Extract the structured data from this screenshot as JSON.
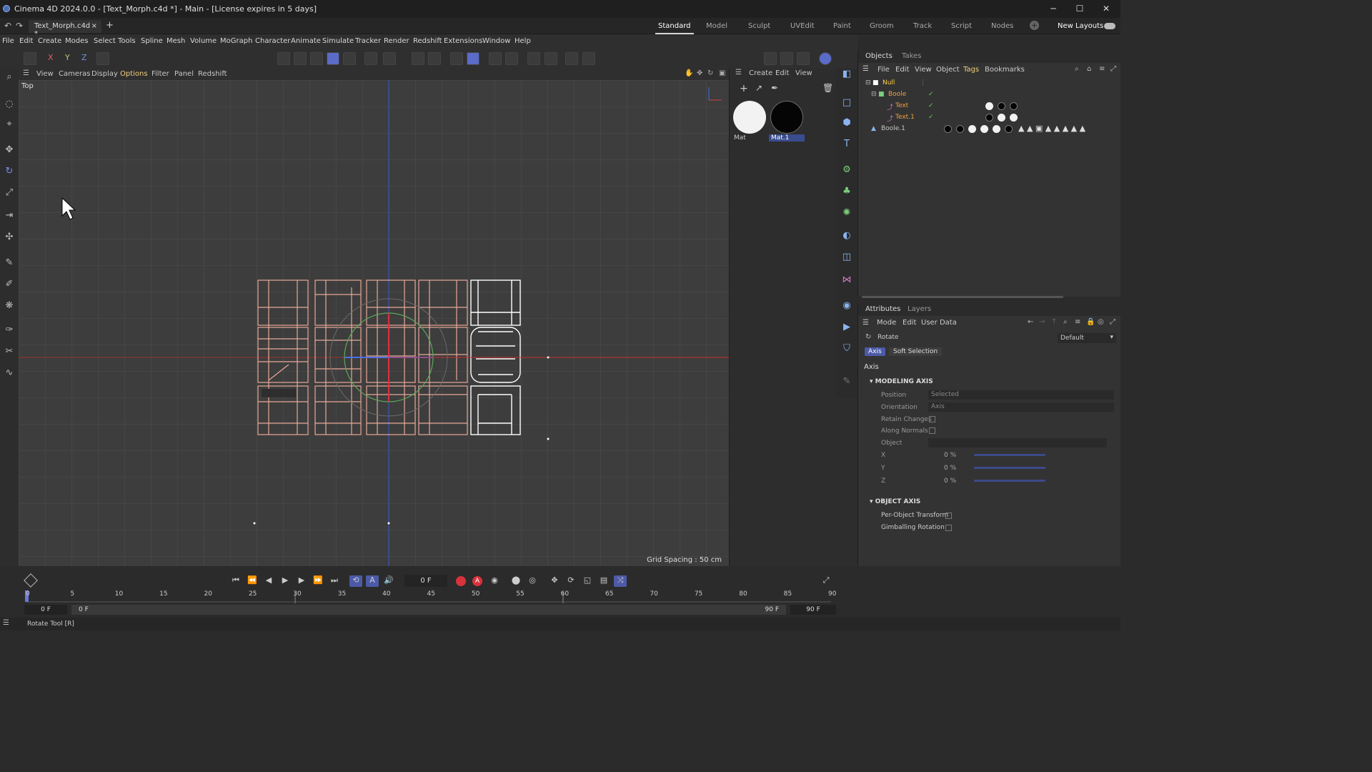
{
  "window": {
    "title": "Cinema 4D 2024.0.0 - [Text_Morph.c4d *] - Main - [License expires in 5 days]"
  },
  "tabs": {
    "doc": "Text_Morph.c4d *",
    "plus": "+",
    "close": "×"
  },
  "layouts": [
    "Standard",
    "Model",
    "Sculpt",
    "UVEdit",
    "Paint",
    "Groom",
    "Track",
    "Script",
    "Nodes"
  ],
  "new_layouts": "New Layouts",
  "menu": [
    "File",
    "Edit",
    "Create",
    "Modes",
    "Select",
    "Tools",
    "Spline",
    "Mesh",
    "Volume",
    "MoGraph",
    "Character",
    "Animate",
    "Simulate",
    "Tracker",
    "Render",
    "Redshift",
    "Extensions",
    "Window",
    "Help"
  ],
  "axes": {
    "x": "X",
    "y": "Y",
    "z": "Z"
  },
  "viewport_menu": [
    "View",
    "Cameras",
    "Display",
    "Options",
    "Filter",
    "Panel",
    "Redshift"
  ],
  "viewport": {
    "label": "Top",
    "grid_spacing": "Grid Spacing : 50 cm"
  },
  "material_menu": [
    "Create",
    "Edit",
    "View"
  ],
  "materials": [
    {
      "name": "Mat",
      "color": "#f2f2f2"
    },
    {
      "name": "Mat.1",
      "color": "#050505"
    }
  ],
  "objects_tabs": [
    "Objects",
    "Takes"
  ],
  "objects_menu": [
    "File",
    "Edit",
    "View",
    "Object",
    "Tags",
    "Bookmarks"
  ],
  "objects": [
    {
      "name": "Null",
      "color": "#ffd24d"
    },
    {
      "name": "Boole",
      "color": "#f0a040"
    },
    {
      "name": "Text",
      "color": "#f0a040"
    },
    {
      "name": "Text.1",
      "color": "#f0a040"
    },
    {
      "name": "Boole.1",
      "color": "#c8c8c8"
    }
  ],
  "attributes": {
    "tabs": [
      "Attributes",
      "Layers"
    ],
    "menu": [
      "Mode",
      "Edit",
      "User Data"
    ],
    "tool": "Rotate",
    "preset": "Default",
    "subtabs": [
      "Axis",
      "Soft Selection"
    ],
    "heading": "Axis",
    "modeling_axis": {
      "title": "MODELING AXIS",
      "position_label": "Position",
      "position_value": "Selected",
      "orientation_label": "Orientation",
      "orientation_value": "Axis",
      "retain_label": "Retain Changes",
      "normals_label": "Along Normals",
      "object_label": "Object",
      "x_label": "X",
      "x_value": "0 %",
      "y_label": "Y",
      "y_value": "0 %",
      "z_label": "Z",
      "z_value": "0 %"
    },
    "object_axis": {
      "title": "OBJECT AXIS",
      "per_object": "Per-Object Transform",
      "gimballing": "Gimballing Rotation"
    }
  },
  "timeline": {
    "frame": "0 F",
    "ticks": [
      "0",
      "5",
      "10",
      "15",
      "20",
      "25",
      "30",
      "35",
      "40",
      "45",
      "50",
      "55",
      "60",
      "65",
      "70",
      "75",
      "80",
      "85",
      "90"
    ],
    "start": "0 F",
    "start2": "0 F",
    "end": "90 F",
    "end2": "90 F"
  },
  "status": "Rotate Tool [R]"
}
